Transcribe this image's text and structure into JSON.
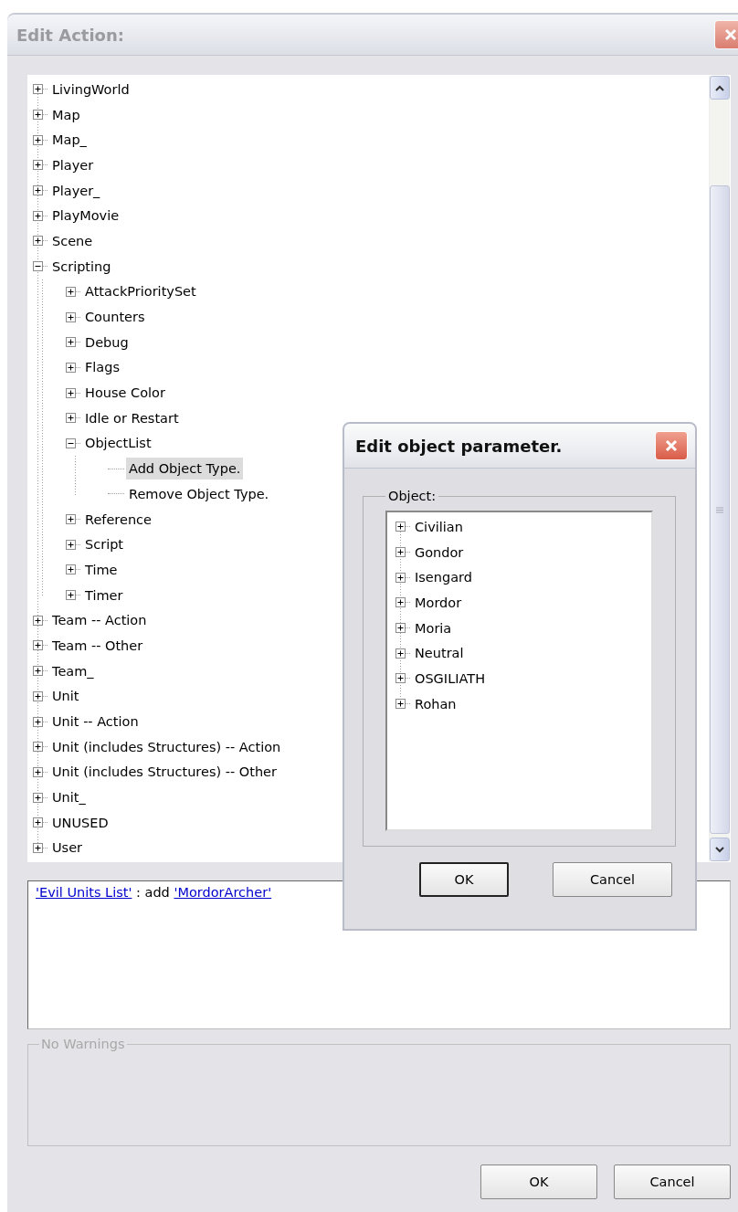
{
  "window": {
    "title": "Edit Action:",
    "active": false
  },
  "tree": {
    "items": [
      {
        "label": "LivingWorld",
        "kind": "branch",
        "expanded": false,
        "selected": false
      },
      {
        "label": "Map",
        "kind": "branch",
        "expanded": false,
        "selected": false
      },
      {
        "label": "Map_",
        "kind": "branch",
        "expanded": false,
        "selected": false
      },
      {
        "label": "Player",
        "kind": "branch",
        "expanded": false,
        "selected": false
      },
      {
        "label": "Player_",
        "kind": "branch",
        "expanded": false,
        "selected": false
      },
      {
        "label": "PlayMovie",
        "kind": "branch",
        "expanded": false,
        "selected": false
      },
      {
        "label": "Scene",
        "kind": "branch",
        "expanded": false,
        "selected": false
      },
      {
        "label": "Scripting",
        "kind": "branch",
        "expanded": true,
        "selected": false,
        "children": [
          {
            "label": "AttackPrioritySet",
            "kind": "branch",
            "expanded": false,
            "selected": false
          },
          {
            "label": "Counters",
            "kind": "branch",
            "expanded": false,
            "selected": false
          },
          {
            "label": "Debug",
            "kind": "branch",
            "expanded": false,
            "selected": false
          },
          {
            "label": "Flags",
            "kind": "branch",
            "expanded": false,
            "selected": false
          },
          {
            "label": "House Color",
            "kind": "branch",
            "expanded": false,
            "selected": false
          },
          {
            "label": "Idle or Restart",
            "kind": "branch",
            "expanded": false,
            "selected": false
          },
          {
            "label": "ObjectList",
            "kind": "branch",
            "expanded": true,
            "selected": false,
            "children": [
              {
                "label": "Add Object Type.",
                "kind": "leaf",
                "selected": true
              },
              {
                "label": "Remove Object Type.",
                "kind": "leaf",
                "selected": false
              }
            ]
          },
          {
            "label": "Reference",
            "kind": "branch",
            "expanded": false,
            "selected": false
          },
          {
            "label": "Script",
            "kind": "branch",
            "expanded": false,
            "selected": false
          },
          {
            "label": "Time",
            "kind": "branch",
            "expanded": false,
            "selected": false
          },
          {
            "label": "Timer",
            "kind": "branch",
            "expanded": false,
            "selected": false
          }
        ]
      },
      {
        "label": "Team -- Action",
        "kind": "branch",
        "expanded": false,
        "selected": false
      },
      {
        "label": "Team -- Other",
        "kind": "branch",
        "expanded": false,
        "selected": false
      },
      {
        "label": "Team_",
        "kind": "branch",
        "expanded": false,
        "selected": false
      },
      {
        "label": "Unit",
        "kind": "branch",
        "expanded": false,
        "selected": false
      },
      {
        "label": "Unit -- Action",
        "kind": "branch",
        "expanded": false,
        "selected": false
      },
      {
        "label": "Unit (includes Structures) -- Action",
        "kind": "branch",
        "expanded": false,
        "selected": false
      },
      {
        "label": "Unit (includes Structures) -- Other",
        "kind": "branch",
        "expanded": false,
        "selected": false
      },
      {
        "label": "Unit_",
        "kind": "branch",
        "expanded": false,
        "selected": false
      },
      {
        "label": "UNUSED",
        "kind": "branch",
        "expanded": false,
        "selected": false
      },
      {
        "label": "User",
        "kind": "branch",
        "expanded": false,
        "selected": false
      }
    ]
  },
  "description": {
    "parts": [
      {
        "kind": "link",
        "text": "'Evil Units List'"
      },
      {
        "kind": "text",
        "text": " : add "
      },
      {
        "kind": "link",
        "text": "'MordorArcher'"
      }
    ]
  },
  "warnings": {
    "label": "No Warnings",
    "disabled": true
  },
  "buttons": [
    {
      "label": "OK"
    },
    {
      "label": "Cancel"
    }
  ],
  "dialog": {
    "title": "Edit object parameter.",
    "active": true,
    "group_label": "Object:",
    "items": [
      {
        "label": "Civilian",
        "kind": "branch",
        "expanded": false,
        "selected": false
      },
      {
        "label": "Gondor",
        "kind": "branch",
        "expanded": false,
        "selected": false
      },
      {
        "label": "Isengard",
        "kind": "branch",
        "expanded": false,
        "selected": false
      },
      {
        "label": "Mordor",
        "kind": "branch",
        "expanded": false,
        "selected": false
      },
      {
        "label": "Moria",
        "kind": "branch",
        "expanded": false,
        "selected": false
      },
      {
        "label": "Neutral",
        "kind": "branch",
        "expanded": false,
        "selected": false
      },
      {
        "label": "OSGILIATH",
        "kind": "branch",
        "expanded": false,
        "selected": false
      },
      {
        "label": "Rohan",
        "kind": "branch",
        "expanded": false,
        "selected": false
      }
    ],
    "buttons": [
      {
        "label": "OK",
        "default": true
      },
      {
        "label": "Cancel",
        "default": false
      }
    ]
  }
}
